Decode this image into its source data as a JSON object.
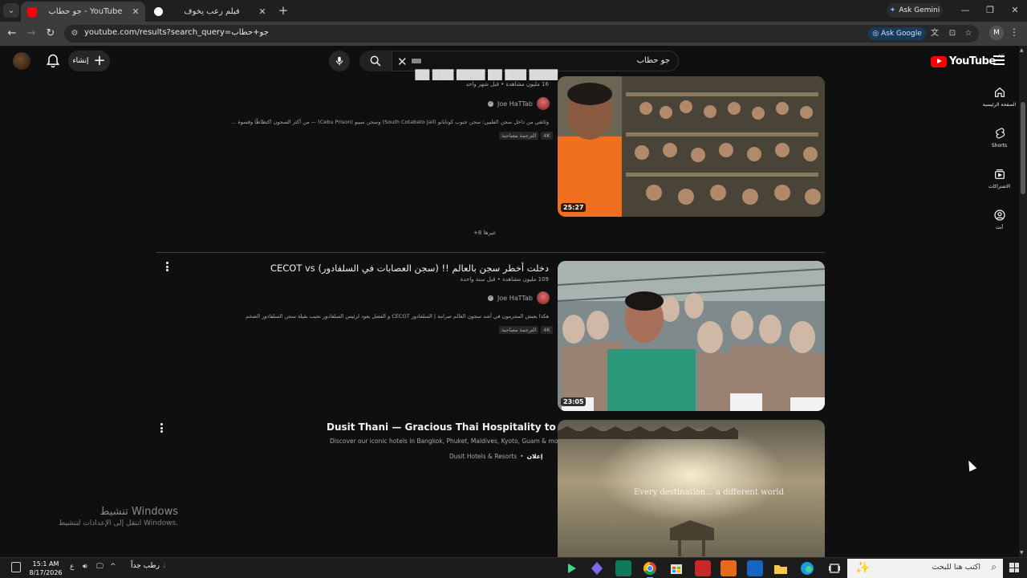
{
  "browser": {
    "tabs": [
      {
        "title": "جو حطاب - YouTube",
        "active": true,
        "icon": "youtube-icon"
      },
      {
        "title": "فيلم رعب يخوف",
        "active": false,
        "icon": "chatgpt-icon"
      }
    ],
    "ask_gemini": "Ask Gemini",
    "url": "youtube.com/results?search_query=جو+حطاب",
    "ask_google": "Ask Google",
    "profile_initial": "M"
  },
  "youtube": {
    "create_label": "إنشاء",
    "search_query": "جو حطاب",
    "logo_text": "YouTube",
    "region": "AE",
    "guide": [
      {
        "label": "الصفحة الرئيسية",
        "icon": "home-icon"
      },
      {
        "label": "Shorts",
        "icon": "shorts-icon"
      },
      {
        "label": "الاشتراكات",
        "icon": "subscriptions-icon"
      },
      {
        "label": "أنت",
        "icon": "you-icon"
      }
    ]
  },
  "results": [
    {
      "meta": "16 مليون مشاهدة • قبل شهر واحد",
      "channel": "Joe HaTTab",
      "description": "وثائقي من داخل سجن الفلبين: سجن جنوب كوتاباتو (South Cotabato Jail) وسجن سيبو (Cebu Prison) — من أكثر السجون اكتظاظًا وقسوة ...",
      "badges": [
        "4K",
        "الترجمة مصاحبة"
      ],
      "duration": "25:27"
    },
    {
      "title": "دخلت أخطر سجن بالعالم !! (سجن العصابات في السلفادور) CECOT vs",
      "meta": "109 مليون مشاهدة • قبل سنة واحدة",
      "channel": "Joe HaTTab",
      "description": "هكذا يعيش المجرمون في أشد سجون العالم صرامة | السلفادور CECOT و الفصل يعود لرئيس السلفادور نجيب بقيلة سجن السلفادور الضخم",
      "badges": [
        "4K",
        "الترجمة مصاحبة"
      ],
      "duration": "23:05"
    }
  ],
  "more_results": "+8 غيرها",
  "ad": {
    "title": "Dusit Thani — Gracious Thai Hospitality to the World",
    "description": "Discover our iconic hotels in Bangkok, Phuket, Maldives, Kyoto, Guam & more",
    "sponsored": "إعلان",
    "advertiser": "Dusit Hotels & Resorts",
    "overlay_text": "Every destination... a different world"
  },
  "windows_activation": {
    "title": "تنشيط Windows",
    "subtitle": "انتقل إلى الإعدادات لتنشيط Windows."
  },
  "taskbar": {
    "search_placeholder": "اكتب هنا للبحث",
    "weather": "رطب جداً",
    "time": "15:1 AM",
    "date": "8/17/2026",
    "lang": "ع"
  }
}
